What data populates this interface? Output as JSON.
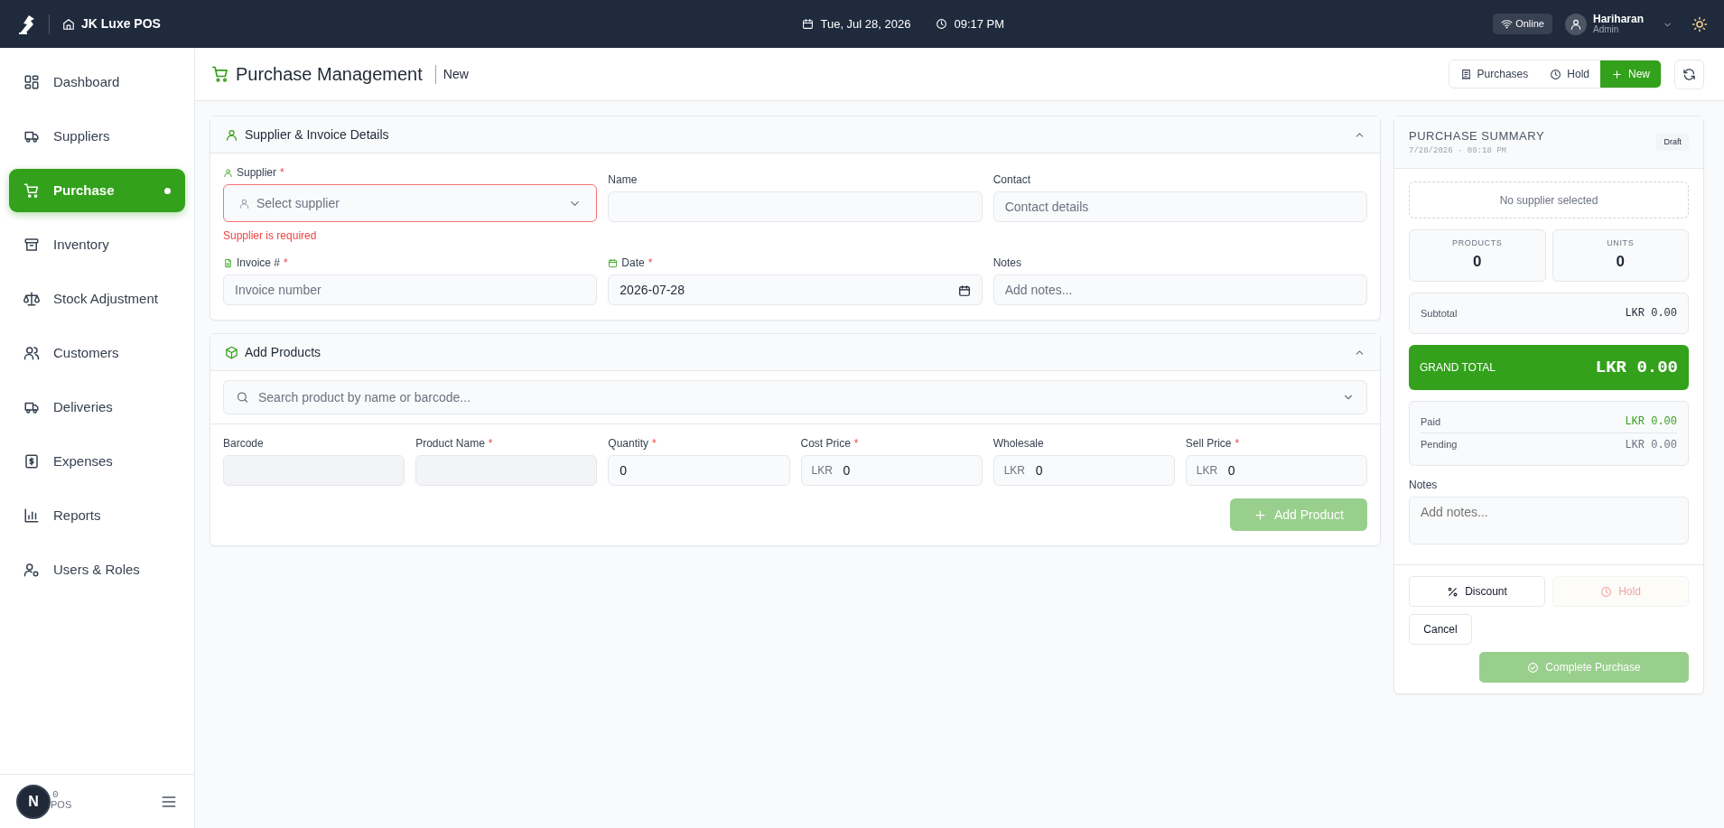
{
  "topbar": {
    "brand": "JK Luxe POS",
    "date": "Tue, Jul 28, 2026",
    "time": "09:17 PM",
    "status": "Online",
    "user": {
      "name": "Hariharan",
      "role": "Admin"
    }
  },
  "sidebar": {
    "items": [
      {
        "label": "Dashboard",
        "selected": false
      },
      {
        "label": "Suppliers",
        "selected": false
      },
      {
        "label": "Purchase",
        "selected": true
      },
      {
        "label": "Inventory",
        "selected": false
      },
      {
        "label": "Stock Adjustment",
        "selected": false
      },
      {
        "label": "Customers",
        "selected": false
      },
      {
        "label": "Deliveries",
        "selected": false
      },
      {
        "label": "Expenses",
        "selected": false
      },
      {
        "label": "Reports",
        "selected": false
      },
      {
        "label": "Users & Roles",
        "selected": false
      }
    ],
    "footer": {
      "badge": "N",
      "texts": [
        "0",
        "POS"
      ]
    }
  },
  "header": {
    "title": "Purchase Management",
    "tag": "New",
    "actions": [
      {
        "label": "Purchases",
        "selected": false
      },
      {
        "label": "Hold",
        "selected": false
      },
      {
        "label": "New",
        "selected": true
      }
    ]
  },
  "supplier_section": {
    "title": "Supplier & Invoice Details",
    "expanded": true,
    "fields": [
      {
        "kind": "select",
        "label": "Supplier",
        "required_mark": "*",
        "placeholder": "Select supplier",
        "error": "Supplier is required"
      },
      {
        "kind": "text",
        "label": "Name"
      },
      {
        "kind": "text",
        "label": "Contact",
        "placeholder": "Contact details"
      },
      {
        "kind": "text",
        "label": "Invoice #",
        "required_mark": "*",
        "placeholder": "Invoice number"
      },
      {
        "kind": "date",
        "label": "Date",
        "required_mark": "*",
        "value": "2026-07-28"
      },
      {
        "kind": "text",
        "label": "Notes",
        "placeholder": "Add notes..."
      }
    ]
  },
  "products_section": {
    "title": "Add Products",
    "expanded": true,
    "search_placeholder": "Search product by name or barcode...",
    "fields": [
      {
        "label": "Barcode",
        "disabled": true
      },
      {
        "label": "Product Name",
        "required_mark": "*",
        "disabled": true
      },
      {
        "label": "Quantity",
        "required_mark": "*",
        "disabled": false,
        "value": "0"
      },
      {
        "label": "Cost Price",
        "required_mark": "*",
        "disabled": false,
        "prefix": "LKR",
        "value": "0"
      },
      {
        "label": "Wholesale",
        "disabled": false,
        "prefix": "LKR",
        "value": "0"
      },
      {
        "label": "Sell Price",
        "required_mark": "*",
        "disabled": false,
        "prefix": "LKR",
        "value": "0"
      }
    ],
    "add_button": {
      "label": "Add Product",
      "disabled": true
    }
  },
  "summary": {
    "title": "PURCHASE SUMMARY",
    "timestamp": "7/28/2026 · 09:18 PM",
    "status": "Draft",
    "supplier": "No supplier selected",
    "stats": [
      {
        "label": "PRODUCTS",
        "value": "0"
      },
      {
        "label": "UNITS",
        "value": "0"
      }
    ],
    "subtotal": {
      "label": "Subtotal",
      "value": "LKR 0.00"
    },
    "grand_total": {
      "label": "GRAND TOTAL",
      "value": "LKR 0.00"
    },
    "payments": [
      {
        "kind": "paid",
        "label": "Paid",
        "value": "LKR 0.00"
      },
      {
        "kind": "pending",
        "label": "Pending",
        "value": "LKR 0.00"
      }
    ],
    "notes": {
      "label": "Notes",
      "placeholder": "Add notes..."
    },
    "buttons": [
      {
        "kind": "discount",
        "label": "Discount",
        "disabled": false
      },
      {
        "kind": "hold",
        "label": "Hold",
        "disabled": true
      },
      {
        "kind": "cancel",
        "label": "Cancel",
        "disabled": false
      },
      {
        "kind": "complete",
        "label": "Complete Purchase",
        "disabled": true
      }
    ]
  }
}
